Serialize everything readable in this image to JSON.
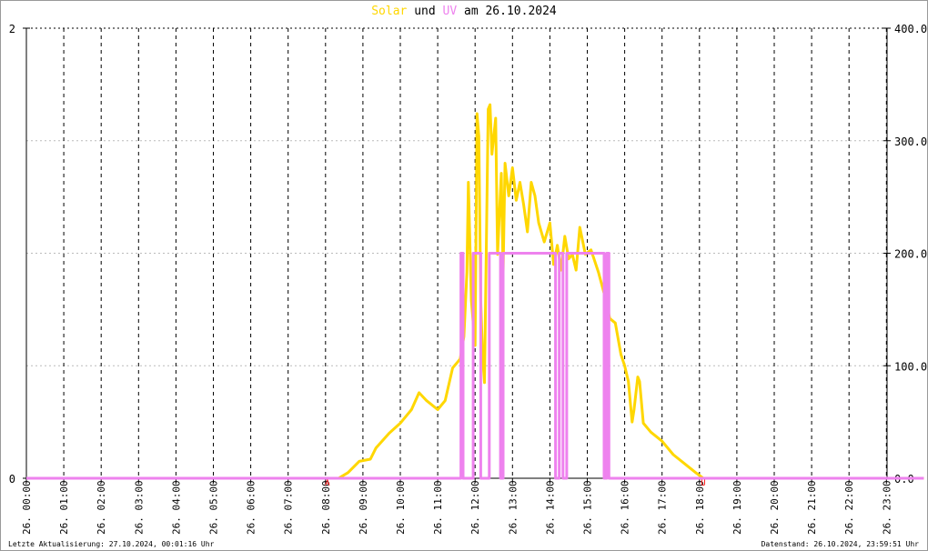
{
  "chart_data": {
    "type": "line",
    "title": {
      "part1": "Solar",
      "part2": " und ",
      "part3": "UV",
      "part4": " am 26.10.2024"
    },
    "colors": {
      "solar": "#ffd700",
      "uv": "#ee82ee",
      "marker": "#ff0000"
    },
    "x_range_hours": [
      0,
      24
    ],
    "left_axis": {
      "range": [
        0,
        2
      ],
      "tick_labels": [
        "2",
        "0"
      ],
      "ticks": [
        2,
        0
      ]
    },
    "right_axis": {
      "range": [
        0,
        400
      ],
      "tick_labels": [
        "400.0",
        "300.0",
        "200.0",
        "100.0",
        "0.0"
      ],
      "ticks": [
        400,
        300,
        200,
        100,
        0
      ]
    },
    "x_tick_labels": [
      "26. 00:00",
      "26. 01:00",
      "26. 02:00",
      "26. 03:00",
      "26. 04:00",
      "26. 05:00",
      "26. 06:00",
      "26. 07:00",
      "26. 08:00",
      "26. 09:00",
      "26. 10:00",
      "26. 11:00",
      "26. 12:00",
      "26. 13:00",
      "26. 14:00",
      "26. 15:00",
      "26. 16:00",
      "26. 17:00",
      "26. 18:00",
      "26. 19:00",
      "26. 20:00",
      "26. 21:00",
      "26. 22:00",
      "26. 23:00"
    ],
    "markers": [
      {
        "label": "A",
        "hour": 8.05
      },
      {
        "label": "U",
        "hour": 18.1
      }
    ],
    "series": [
      {
        "name": "Solar",
        "axis": "right",
        "points": [
          [
            0,
            0
          ],
          [
            8.35,
            0
          ],
          [
            8.6,
            5
          ],
          [
            8.9,
            15
          ],
          [
            9.2,
            17
          ],
          [
            9.35,
            27
          ],
          [
            9.7,
            40
          ],
          [
            10.0,
            49
          ],
          [
            10.3,
            61
          ],
          [
            10.5,
            76
          ],
          [
            10.7,
            69
          ],
          [
            11.0,
            61
          ],
          [
            11.2,
            69
          ],
          [
            11.4,
            98
          ],
          [
            11.6,
            106
          ],
          [
            11.7,
            126
          ],
          [
            11.78,
            183
          ],
          [
            11.82,
            263
          ],
          [
            11.9,
            158
          ],
          [
            12.0,
            118
          ],
          [
            12.05,
            324
          ],
          [
            12.1,
            304
          ],
          [
            12.15,
            158
          ],
          [
            12.2,
            110
          ],
          [
            12.25,
            85
          ],
          [
            12.35,
            328
          ],
          [
            12.4,
            332
          ],
          [
            12.45,
            288
          ],
          [
            12.55,
            320
          ],
          [
            12.6,
            199
          ],
          [
            12.7,
            271
          ],
          [
            12.75,
            183
          ],
          [
            12.8,
            280
          ],
          [
            12.9,
            251
          ],
          [
            13.0,
            276
          ],
          [
            13.1,
            247
          ],
          [
            13.2,
            263
          ],
          [
            13.3,
            243
          ],
          [
            13.4,
            219
          ],
          [
            13.5,
            263
          ],
          [
            13.6,
            251
          ],
          [
            13.7,
            227
          ],
          [
            13.85,
            210
          ],
          [
            14.0,
            227
          ],
          [
            14.1,
            190
          ],
          [
            14.2,
            207
          ],
          [
            14.3,
            185
          ],
          [
            14.4,
            215
          ],
          [
            14.5,
            195
          ],
          [
            14.6,
            199
          ],
          [
            14.7,
            185
          ],
          [
            14.8,
            223
          ],
          [
            14.95,
            199
          ],
          [
            15.1,
            203
          ],
          [
            15.3,
            183
          ],
          [
            15.5,
            158
          ],
          [
            15.6,
            142
          ],
          [
            15.75,
            138
          ],
          [
            15.9,
            110
          ],
          [
            16.0,
            100
          ],
          [
            16.1,
            86
          ],
          [
            16.2,
            50
          ],
          [
            16.25,
            61
          ],
          [
            16.35,
            90
          ],
          [
            16.4,
            86
          ],
          [
            16.5,
            49
          ],
          [
            16.7,
            41
          ],
          [
            17.0,
            33
          ],
          [
            17.3,
            21
          ],
          [
            17.6,
            13
          ],
          [
            17.9,
            5
          ],
          [
            18.1,
            0
          ],
          [
            24,
            0
          ]
        ]
      },
      {
        "name": "UV",
        "axis": "left",
        "points": [
          [
            0,
            0
          ],
          [
            11.62,
            0
          ],
          [
            11.62,
            1
          ],
          [
            11.68,
            1
          ],
          [
            11.68,
            0
          ],
          [
            11.95,
            0
          ],
          [
            11.95,
            1
          ],
          [
            12.15,
            1
          ],
          [
            12.15,
            0
          ],
          [
            12.38,
            0
          ],
          [
            12.38,
            1
          ],
          [
            12.68,
            1
          ],
          [
            12.68,
            0
          ],
          [
            12.75,
            0
          ],
          [
            12.75,
            1
          ],
          [
            14.15,
            1
          ],
          [
            14.15,
            0
          ],
          [
            14.25,
            0
          ],
          [
            14.25,
            1
          ],
          [
            14.35,
            1
          ],
          [
            14.35,
            0
          ],
          [
            14.45,
            0
          ],
          [
            14.45,
            1
          ],
          [
            15.45,
            1
          ],
          [
            15.45,
            0
          ],
          [
            15.52,
            0
          ],
          [
            15.52,
            1
          ],
          [
            15.58,
            1
          ],
          [
            15.58,
            0
          ],
          [
            24,
            0
          ]
        ]
      }
    ]
  },
  "footer": {
    "left": "Letzte Aktualisierung: 27.10.2024, 00:01:16 Uhr",
    "right": "Datenstand: 26.10.2024, 23:59:51 Uhr"
  }
}
